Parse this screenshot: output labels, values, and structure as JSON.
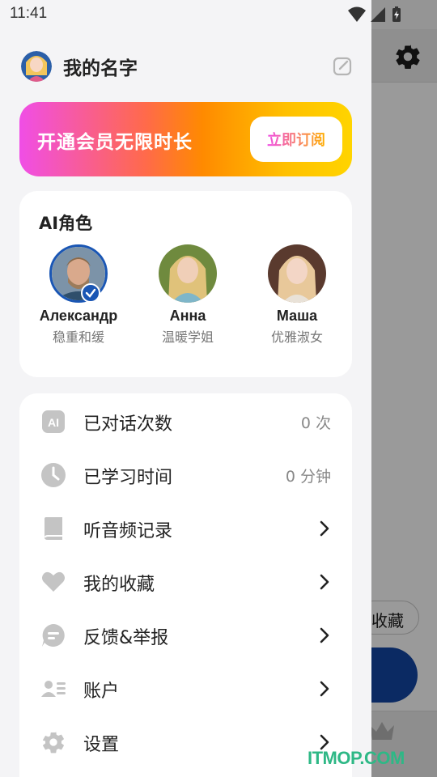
{
  "status_bar": {
    "time": "11:41"
  },
  "profile": {
    "name": "我的名字"
  },
  "vip": {
    "text": "开通会员无限时长",
    "button": "立即订阅"
  },
  "ai_section": {
    "title": "AI角色",
    "characters": [
      {
        "name": "Александр",
        "desc": "稳重和缓",
        "selected": true
      },
      {
        "name": "Анна",
        "desc": "温暖学姐",
        "selected": false
      },
      {
        "name": "Маша",
        "desc": "优雅淑女",
        "selected": false
      }
    ]
  },
  "menu": [
    {
      "label": "已对话次数",
      "value": "0 次",
      "icon": "ai-icon"
    },
    {
      "label": "已学习时间",
      "value": "0 分钟",
      "icon": "clock-icon"
    },
    {
      "label": "听音频记录",
      "icon": "book-icon"
    },
    {
      "label": "我的收藏",
      "icon": "heart-icon"
    },
    {
      "label": "反馈&举报",
      "icon": "feedback-icon"
    },
    {
      "label": "账户",
      "icon": "account-icon"
    },
    {
      "label": "设置",
      "icon": "gear-icon"
    }
  ],
  "background": {
    "favorite_chip": "收藏"
  },
  "watermark": "ITMOP.COM",
  "colors": {
    "accent_blue": "#1a56b4",
    "icon_gray": "#c4c4c4",
    "vip_gradient_start": "#f04ee6",
    "vip_gradient_end": "#ffd400"
  }
}
